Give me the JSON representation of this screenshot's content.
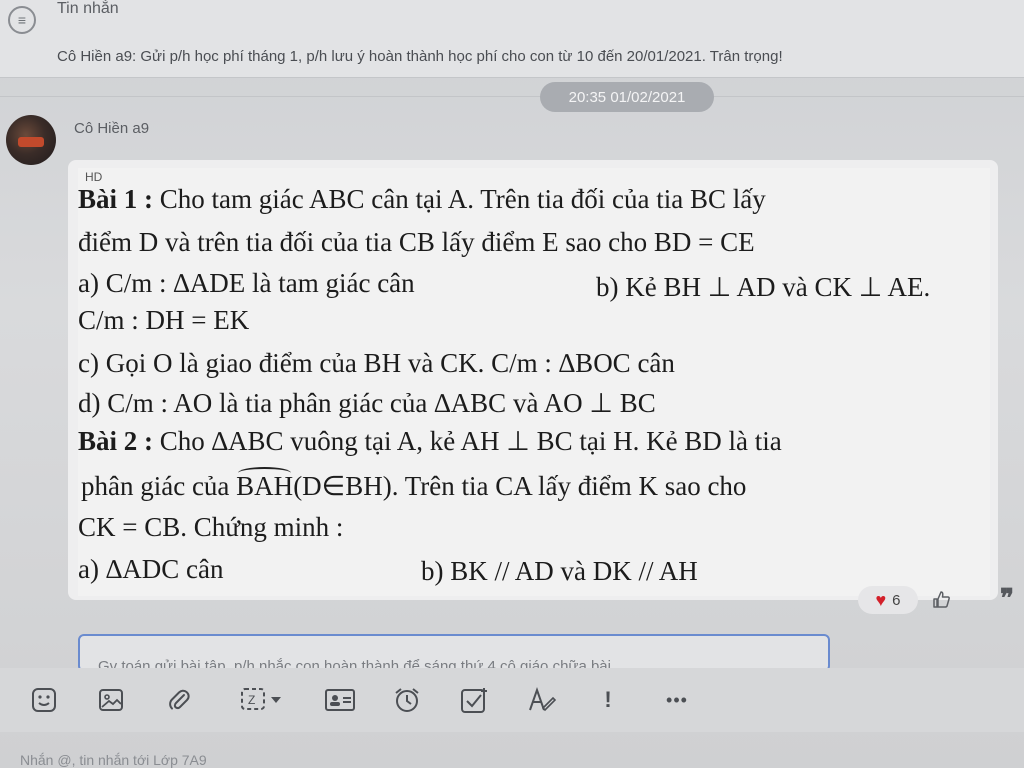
{
  "pinned": {
    "title": "Tin nhắn",
    "text": "Cô Hiền a9: Gửi p/h học phí tháng 1, p/h lưu ý hoàn thành học phí cho con từ 10 đến 20/01/2021. Trân trọng!"
  },
  "timestamp": "20:35 01/02/2021",
  "message": {
    "sender": "Cô Hiền a9",
    "image_label": "HD",
    "lines": {
      "l1_bold": "Bài 1 :",
      "l1": " Cho tam giác ABC cân tại A. Trên tia đối của tia BC lấy",
      "l2": "điểm D và trên tia đối của tia CB lấy điểm E sao cho BD = CE",
      "l3a": "a) C/m : ∆ADE là tam giác cân",
      "l3b": "b) Kẻ BH ⊥ AD và CK ⊥ AE.",
      "l4": "C/m : DH = EK",
      "l5": "c) Gọi O là giao điểm của BH và CK. C/m : ∆BOC cân",
      "l6": "d) C/m : AO là tia phân giác của ∆ABC và AO ⊥ BC",
      "l7_bold": "Bài 2 :",
      "l7": " Cho ∆ABC vuông tại A, kẻ AH ⊥ BC tại H. Kẻ BD là tia",
      "l8a": "phân giác của ",
      "l8_arc": "BAH",
      "l8b": "(D∈BH). Trên tia CA lấy điểm K sao cho",
      "l9": "CK = CB. Chứng minh :",
      "l10a": "a) ∆ADC cân",
      "l10b": "b) BK // AD và DK // AH"
    },
    "reaction_count": "6"
  },
  "input": {
    "text": "Gv toán gửi bài tập, p/h nhắc con hoàn thành để sáng thứ 4 cô giáo chữa bài"
  },
  "toolbar": {
    "more": "•••",
    "exclaim": "!"
  },
  "footer": {
    "text": "Nhắn @, tin nhắn tới Lớp 7A9"
  },
  "colors": {
    "heart": "#d3202a",
    "input_border": "#6a8bcf",
    "time_badge": "#a9acb1"
  }
}
